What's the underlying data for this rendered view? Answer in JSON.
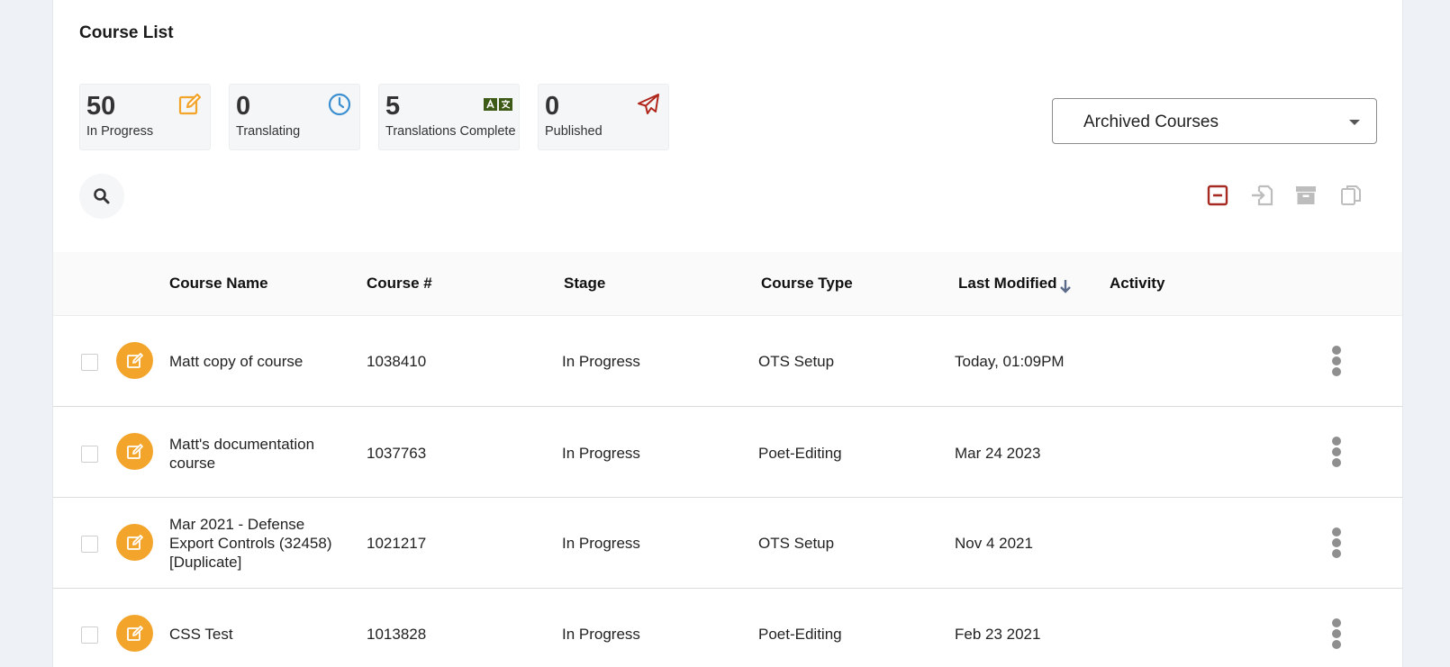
{
  "page_title": "Course List",
  "stats": [
    {
      "value": "50",
      "label": "In Progress",
      "icon": "edit-icon",
      "color": "#f3a42a"
    },
    {
      "value": "0",
      "label": "Translating",
      "icon": "clock-icon",
      "color": "#3b8fd1"
    },
    {
      "value": "5",
      "label": "Translations Complete",
      "icon": "translate-icon",
      "color": "#3d5a16"
    },
    {
      "value": "0",
      "label": "Published",
      "icon": "paper-plane-icon",
      "color": "#b1261c"
    }
  ],
  "filter": {
    "selected": "Archived Courses"
  },
  "toolbar": {
    "icons": [
      "deselect-icon",
      "import-icon",
      "archive-icon",
      "copy-icon"
    ],
    "accent_color": "#a52a22",
    "disabled_color": "#bdbdbd"
  },
  "table": {
    "headers": {
      "course_name": "Course Name",
      "course_number": "Course #",
      "stage": "Stage",
      "course_type": "Course Type",
      "last_modified": "Last Modified",
      "activity": "Activity"
    },
    "sort": {
      "column": "Last Modified",
      "direction": "descending"
    },
    "rows": [
      {
        "name": "Matt copy of course",
        "number": "1038410",
        "stage": "In Progress",
        "type": "OTS Setup",
        "modified": "Today, 01:09PM"
      },
      {
        "name": "Matt's documentation course",
        "number": "1037763",
        "stage": "In Progress",
        "type": "Poet-Editing",
        "modified": "Mar 24 2023"
      },
      {
        "name": "Mar 2021 - Defense Export Controls (32458) [Duplicate]",
        "number": "1021217",
        "stage": "In Progress",
        "type": "OTS Setup",
        "modified": "Nov 4 2021"
      },
      {
        "name": "CSS Test",
        "number": "1013828",
        "stage": "In Progress",
        "type": "Poet-Editing",
        "modified": "Feb 23 2021"
      }
    ]
  },
  "colors": {
    "badge": "#f3a42a",
    "page_bg": "#eef2f7"
  }
}
